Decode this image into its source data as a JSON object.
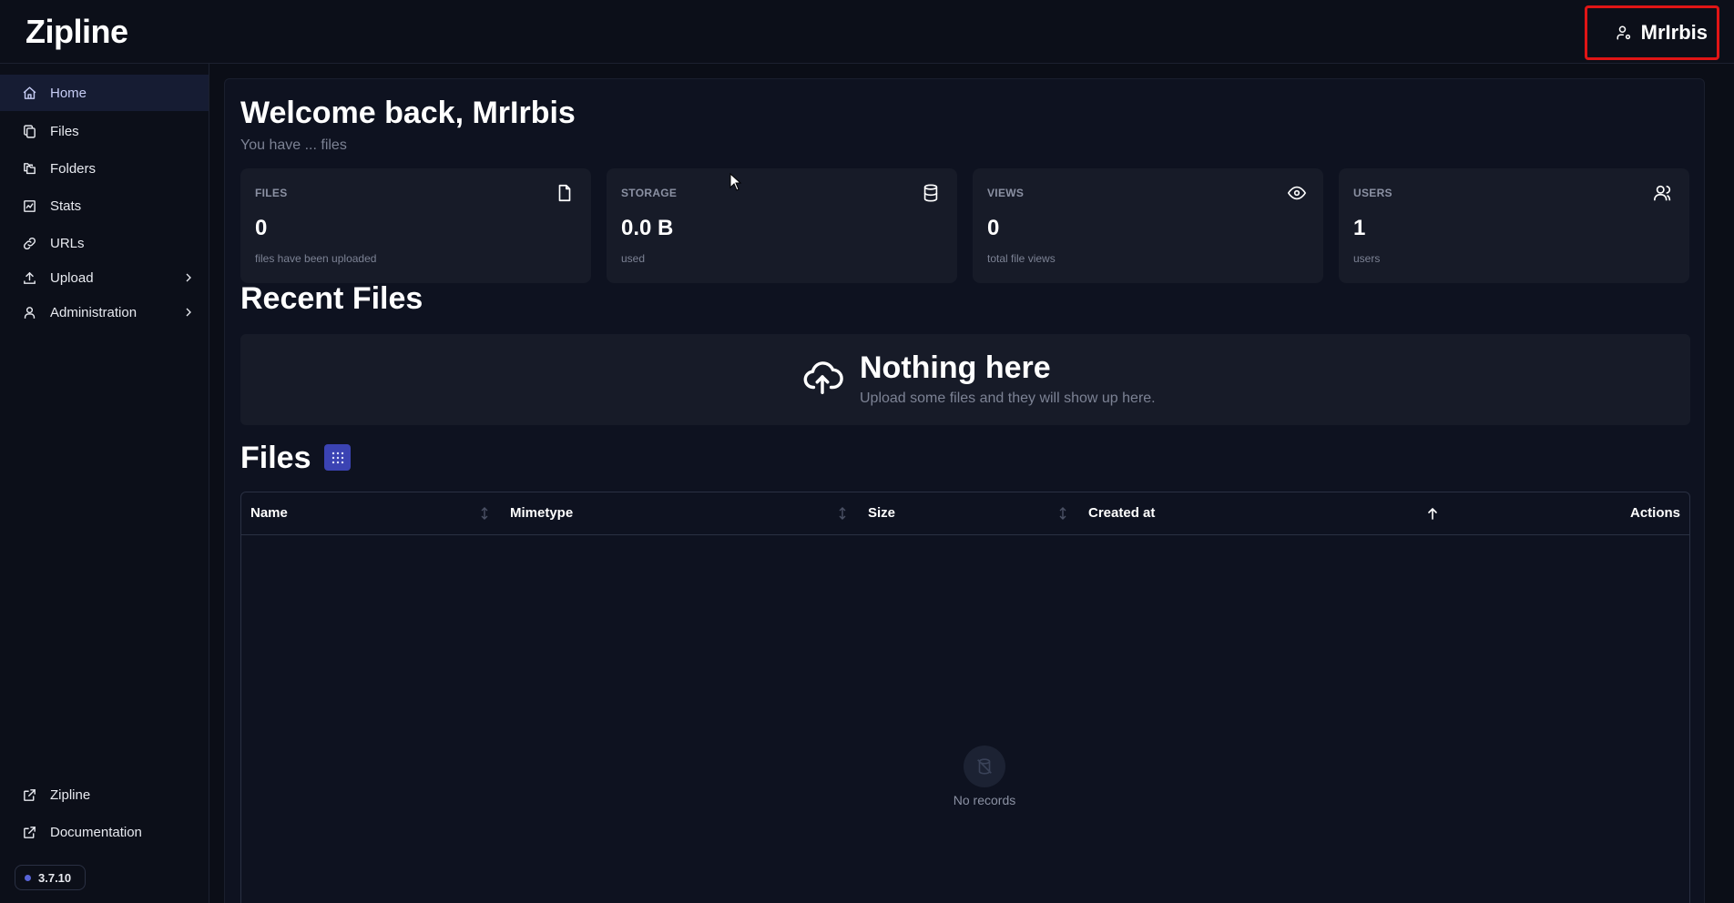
{
  "header": {
    "brand": "Zipline",
    "username": "MrIrbis"
  },
  "sidebar": {
    "items": [
      {
        "label": "Home",
        "icon": "home-icon",
        "active": true
      },
      {
        "label": "Files",
        "icon": "files-icon"
      },
      {
        "label": "Folders",
        "icon": "folders-icon"
      },
      {
        "label": "Stats",
        "icon": "stats-icon"
      },
      {
        "label": "URLs",
        "icon": "link-icon"
      },
      {
        "label": "Upload",
        "icon": "upload-icon",
        "expandable": true
      },
      {
        "label": "Administration",
        "icon": "user-icon",
        "expandable": true
      }
    ],
    "footer_items": [
      {
        "label": "Zipline",
        "icon": "external-link-icon"
      },
      {
        "label": "Documentation",
        "icon": "external-link-icon"
      }
    ],
    "version": "3.7.10"
  },
  "main": {
    "welcome": "Welcome back, MrIrbis",
    "subtitle": "You have ... files",
    "stats": [
      {
        "label": "FILES",
        "value": "0",
        "desc": "files have been uploaded",
        "icon": "file-icon"
      },
      {
        "label": "STORAGE",
        "value": "0.0 B",
        "desc": "used",
        "icon": "database-icon"
      },
      {
        "label": "VIEWS",
        "value": "0",
        "desc": "total file views",
        "icon": "eye-icon"
      },
      {
        "label": "USERS",
        "value": "1",
        "desc": "users",
        "icon": "users-icon"
      }
    ],
    "recent": {
      "title": "Recent Files",
      "empty_title": "Nothing here",
      "empty_desc": "Upload some files and they will show up here."
    },
    "files": {
      "title": "Files",
      "columns": [
        "Name",
        "Mimetype",
        "Size",
        "Created at",
        "Actions"
      ],
      "empty": "No records"
    }
  },
  "colors": {
    "background": "#0b0e17",
    "accent": "#3b43b3",
    "highlight": "#e01515"
  }
}
